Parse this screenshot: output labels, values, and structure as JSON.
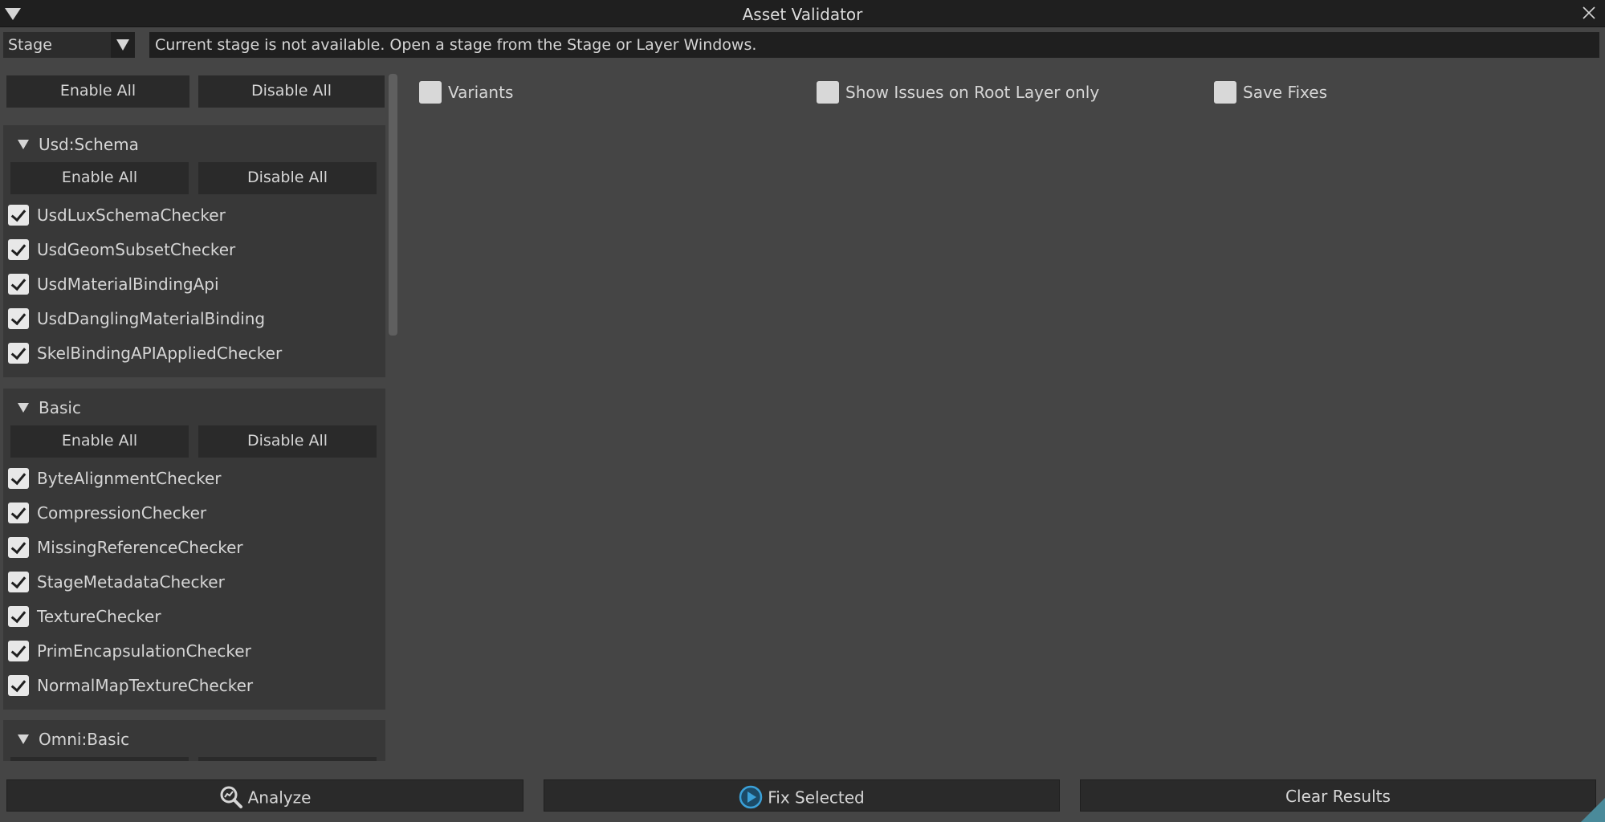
{
  "window": {
    "title": "Asset Validator"
  },
  "stage_selector": {
    "value": "Stage",
    "message": "Current stage is not available. Open a stage from the Stage or Layer Windows."
  },
  "top_buttons": {
    "enable_all": "Enable All",
    "disable_all": "Disable All"
  },
  "sections": [
    {
      "title": "Usd:Schema",
      "enable_all": "Enable All",
      "disable_all": "Disable All",
      "checkers": [
        {
          "label": "UsdLuxSchemaChecker",
          "checked": true
        },
        {
          "label": "UsdGeomSubsetChecker",
          "checked": true
        },
        {
          "label": "UsdMaterialBindingApi",
          "checked": true
        },
        {
          "label": "UsdDanglingMaterialBinding",
          "checked": true
        },
        {
          "label": "SkelBindingAPIAppliedChecker",
          "checked": true
        }
      ]
    },
    {
      "title": "Basic",
      "enable_all": "Enable All",
      "disable_all": "Disable All",
      "checkers": [
        {
          "label": "ByteAlignmentChecker",
          "checked": true
        },
        {
          "label": "CompressionChecker",
          "checked": true
        },
        {
          "label": "MissingReferenceChecker",
          "checked": true
        },
        {
          "label": "StageMetadataChecker",
          "checked": true
        },
        {
          "label": "TextureChecker",
          "checked": true
        },
        {
          "label": "PrimEncapsulationChecker",
          "checked": true
        },
        {
          "label": "NormalMapTextureChecker",
          "checked": true
        }
      ]
    },
    {
      "title": "Omni:Basic"
    }
  ],
  "options": [
    {
      "label": "Variants",
      "checked": false
    },
    {
      "label": "Show Issues on Root Layer only",
      "checked": false
    },
    {
      "label": "Save Fixes",
      "checked": false
    }
  ],
  "bottom": {
    "analyze": "Analyze",
    "fix_selected": "Fix Selected",
    "clear_results": "Clear Results"
  }
}
